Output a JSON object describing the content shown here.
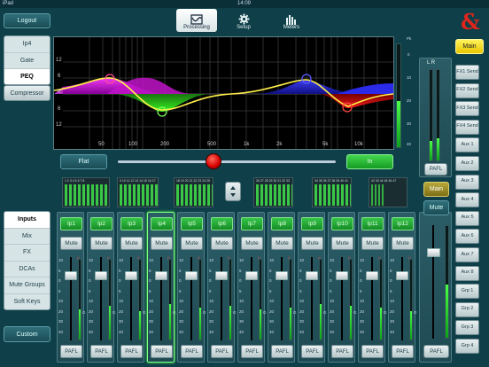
{
  "status_bar": {
    "device": "iPad",
    "time": "14:09"
  },
  "header": {
    "logout_label": "Logout",
    "tabs": [
      {
        "label": "Processing",
        "icon": "eq-curve-icon",
        "selected": true
      },
      {
        "label": "Setup",
        "icon": "gear-icon",
        "selected": false
      },
      {
        "label": "Meters",
        "icon": "meters-icon",
        "selected": false
      }
    ],
    "brand_logo": "&"
  },
  "processing_menu": {
    "items": [
      {
        "label": "Ip4",
        "selected": false
      },
      {
        "label": "Gate",
        "selected": false
      },
      {
        "label": "PEQ",
        "selected": true
      }
    ],
    "compressor_label": "Compressor"
  },
  "eq": {
    "y_ticks": [
      "12",
      "6",
      "0",
      "6",
      "12"
    ],
    "x_ticks": [
      "50",
      "100",
      "200",
      "500",
      "1k",
      "2k",
      "5k",
      "10k"
    ],
    "flat_label": "Flat",
    "in_label": "In",
    "meter_scale": [
      "Pk",
      "0",
      "10",
      "20",
      "30",
      "40"
    ]
  },
  "mixer_nav": {
    "items": [
      {
        "label": "Inputs",
        "selected": true
      },
      {
        "label": "Mix",
        "selected": false
      },
      {
        "label": "FX",
        "selected": false
      },
      {
        "label": "DCAs",
        "selected": false
      },
      {
        "label": "Mute Groups",
        "selected": false
      },
      {
        "label": "Soft Keys",
        "selected": false
      }
    ],
    "custom_label": "Custom"
  },
  "meter_banks": [
    {
      "labels": "1 2 3 4 5 6 7 8"
    },
    {
      "labels": "9 10 11 12 13 14 15 16 17"
    },
    {
      "labels": "18 19 20 21 22 23 24 25"
    },
    {
      "labels": "26 27 28 29 30 31 32 33"
    },
    {
      "labels": "34 35 36 37 38 39 40 41"
    },
    {
      "labels": "42 43 44 45 46 47"
    }
  ],
  "channels": [
    {
      "name": "Ip1",
      "mute": "Mute",
      "pafl": "PAFL",
      "level": 0.38,
      "fader": 0.78
    },
    {
      "name": "Ip2",
      "mute": "Mute",
      "pafl": "PAFL",
      "level": 0.42,
      "fader": 0.78
    },
    {
      "name": "Ip3",
      "mute": "Mute",
      "pafl": "PAFL",
      "level": 0.36,
      "fader": 0.78
    },
    {
      "name": "Ip4",
      "mute": "Mute",
      "pafl": "PAFL",
      "level": 0.44,
      "fader": 0.78,
      "selected": true
    },
    {
      "name": "Ip5",
      "mute": "Mute",
      "pafl": "PAFL",
      "level": 0.4,
      "fader": 0.78
    },
    {
      "name": "Ip6",
      "mute": "Mute",
      "pafl": "PAFL",
      "level": 0.42,
      "fader": 0.78
    },
    {
      "name": "Ip7",
      "mute": "Mute",
      "pafl": "PAFL",
      "level": 0.38,
      "fader": 0.78
    },
    {
      "name": "Ip8",
      "mute": "Mute",
      "pafl": "PAFL",
      "level": 0.4,
      "fader": 0.78
    },
    {
      "name": "Ip9",
      "mute": "Mute",
      "pafl": "PAFL",
      "level": 0.44,
      "fader": 0.78
    },
    {
      "name": "Ip10",
      "mute": "Mute",
      "pafl": "PAFL",
      "level": 0.42,
      "fader": 0.78
    },
    {
      "name": "Ip11",
      "mute": "Mute",
      "pafl": "PAFL",
      "level": 0.4,
      "fader": 0.78
    },
    {
      "name": "Ip12",
      "mute": "Mute",
      "pafl": "PAFL",
      "level": 0.36,
      "fader": 0.78
    }
  ],
  "fader_scale": [
    "10",
    "5",
    "0",
    "5",
    "10",
    "20",
    "30",
    "40"
  ],
  "main_mix": {
    "main_label": "Main",
    "lr_label": "L  R",
    "pafl_label": "PAFL",
    "strip_main_label": "Main",
    "mute_label": "Mute",
    "master_pafl_label": "PAFL"
  },
  "sends": [
    "FX1 Send",
    "FX2 Send",
    "FX3 Send",
    "FX4 Send",
    "Aux 1",
    "Aux 2",
    "Aux 3",
    "Aux 4",
    "Aux 5",
    "Aux 6",
    "Aux 7",
    "Aux 8",
    "Grp 1",
    "Grp 2",
    "Grp 3",
    "Grp 4"
  ]
}
